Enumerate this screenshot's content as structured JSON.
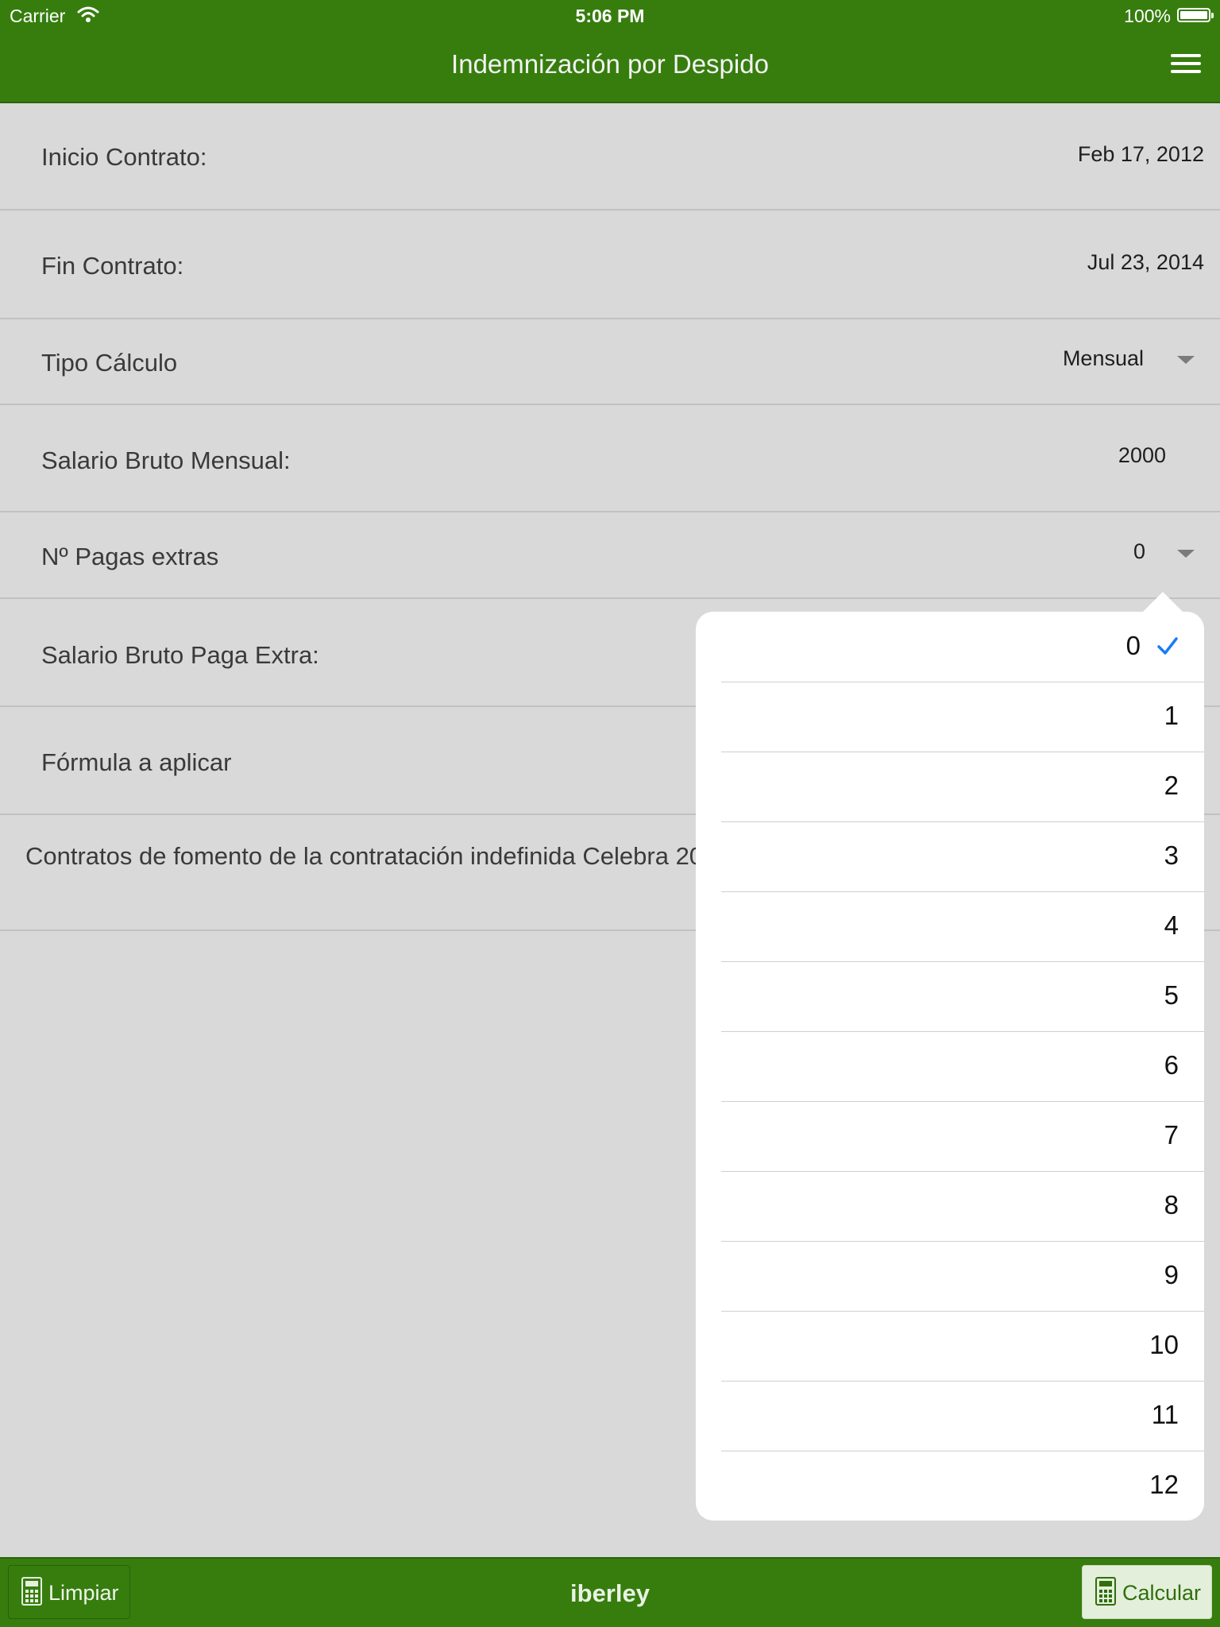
{
  "status_bar": {
    "carrier": "Carrier",
    "time": "5:06 PM",
    "battery": "100%"
  },
  "header": {
    "title": "Indemnización por Despido"
  },
  "form": {
    "inicio": {
      "label": "Inicio Contrato:",
      "value": "Feb 17, 2012"
    },
    "fin": {
      "label": "Fin Contrato:",
      "value": "Jul 23, 2014"
    },
    "tipo": {
      "label": "Tipo Cálculo",
      "value": "Mensual"
    },
    "salario": {
      "label": "Salario Bruto Mensual:",
      "value": "2000"
    },
    "pagas": {
      "label": "Nº Pagas extras",
      "value": "0"
    },
    "salario_extra": {
      "label": "Salario Bruto Paga Extra:"
    },
    "formula": {
      "label": "Fórmula a aplicar",
      "value": "Contratos de fomento de la contratación indefinida Celebra 2012"
    }
  },
  "picker": {
    "options": [
      "0",
      "1",
      "2",
      "3",
      "4",
      "5",
      "6",
      "7",
      "8",
      "9",
      "10",
      "11",
      "12"
    ],
    "selected": "0",
    "check_color": "#1a7cf5"
  },
  "toolbar": {
    "limpiar": "Limpiar",
    "brand": "iberley",
    "calcular": "Calcular"
  },
  "colors": {
    "accent": "#367d0e",
    "background": "#d9d9d9"
  }
}
